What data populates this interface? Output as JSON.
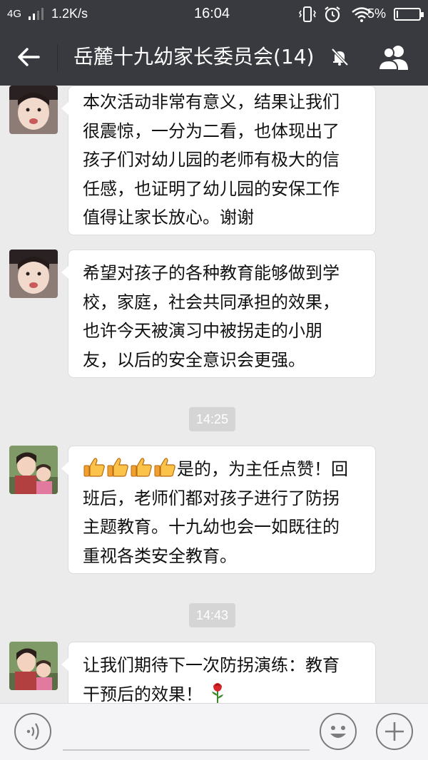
{
  "status_bar": {
    "network": "4G",
    "speed": "1.2K/s",
    "time": "16:04",
    "battery": "5%",
    "battery_level": 0.05
  },
  "header": {
    "title": "岳麓十九幼家长委员会(14)",
    "back_icon": "back-arrow-icon",
    "mute_icon": "bell-muted-icon",
    "members_icon": "group-members-icon"
  },
  "messages": [
    {
      "avatar": "child-avatar",
      "lines": [
        "本次活动非常有意义，结果让我们",
        "很震惊，一分为二看，也体现出了",
        "孩子们对幼儿园的老师有极大的信",
        "任感，也证明了幼儿园的安保工作",
        "值得让家长放心。谢谢"
      ]
    },
    {
      "avatar": "child-avatar",
      "lines": [
        "希望对孩子的各种教育能够做到学",
        "校，家庭，社会共同承担的效果，",
        "也许今天被演习中被拐走的小朋",
        "友，以后的安全意识会更强。"
      ]
    },
    {
      "timestamp": "14:25"
    },
    {
      "avatar": "mother-child-avatar",
      "emoji": "thumbs-up-emoji",
      "emoji_count": 4,
      "lines": [
        "是的，为主任点赞！回",
        "班后，老师们都对孩子进行了防拐",
        "主题教育。十九幼也会一如既往的",
        "重视各类安全教育。"
      ]
    },
    {
      "timestamp": "14:43"
    },
    {
      "avatar": "mother-child-avatar",
      "emoji": "rose-emoji",
      "lines": [
        "让我们期待下一次防拐演练：教育",
        "干预后的效果！"
      ]
    }
  ],
  "bottom_bar": {
    "voice_icon": "voice-input-icon",
    "emoji_icon": "emoji-smile-icon",
    "plus_icon": "plus-icon",
    "input_value": ""
  },
  "colors": {
    "bar_bg": "#393a3f",
    "chat_bg": "#ebebeb",
    "bubble_bg": "#ffffff",
    "timestamp_bg": "#d5d5d5"
  }
}
